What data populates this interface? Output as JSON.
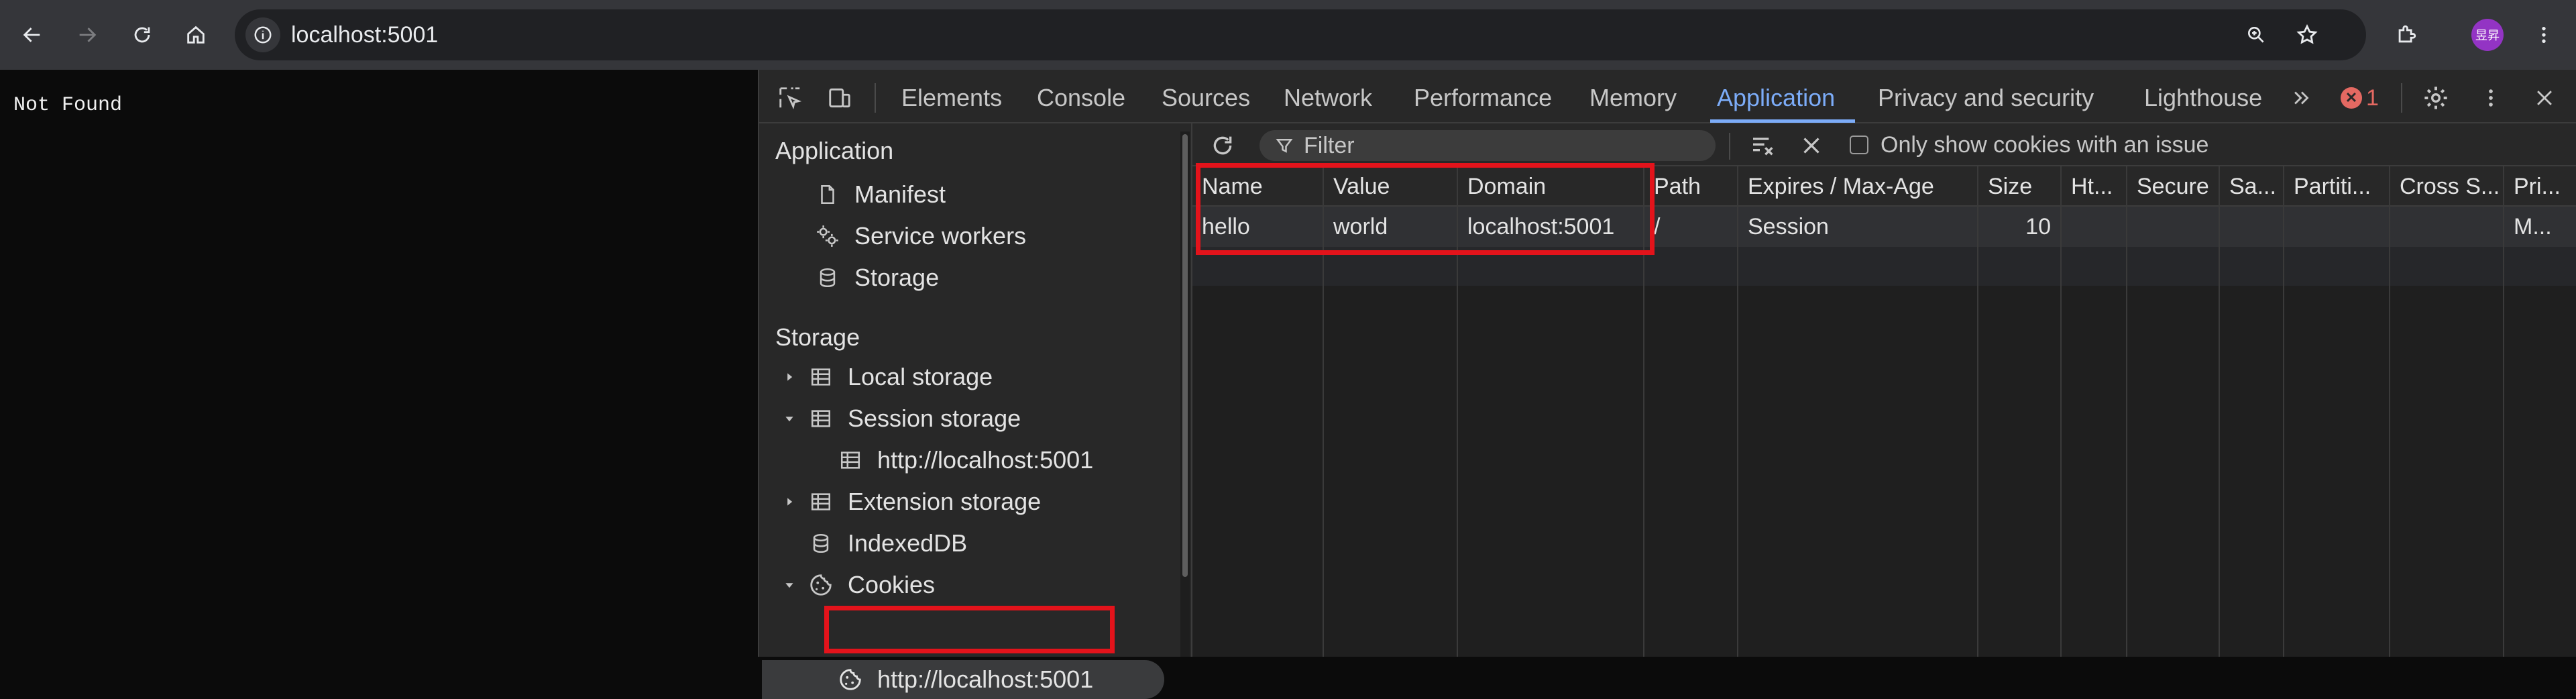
{
  "browser": {
    "url": "localhost:5001",
    "avatar_text": "昱昇"
  },
  "page": {
    "text": "Not Found"
  },
  "devtools": {
    "tabs": [
      "Elements",
      "Console",
      "Sources",
      "Network",
      "Performance",
      "Memory",
      "Application",
      "Privacy and security",
      "Lighthouse"
    ],
    "active_tab": "Application",
    "error_count": "1",
    "sidebar": {
      "application_heading": "Application",
      "application_items": [
        {
          "label": "Manifest",
          "icon": "file-icon"
        },
        {
          "label": "Service workers",
          "icon": "gears-icon"
        },
        {
          "label": "Storage",
          "icon": "database-icon"
        }
      ],
      "storage_heading": "Storage",
      "storage_items": [
        {
          "label": "Local storage",
          "icon": "table-icon",
          "expanded": false
        },
        {
          "label": "Session storage",
          "icon": "table-icon",
          "expanded": true
        },
        {
          "label": "http://localhost:5001",
          "icon": "table-icon",
          "child": true
        },
        {
          "label": "Extension storage",
          "icon": "table-icon",
          "expanded": false
        },
        {
          "label": "IndexedDB",
          "icon": "database-icon"
        },
        {
          "label": "Cookies",
          "icon": "cookie-icon",
          "expanded": true
        },
        {
          "label": "http://localhost:5001",
          "icon": "cookie-icon",
          "child": true,
          "selected": true
        }
      ]
    },
    "cookies": {
      "filter_placeholder": "Filter",
      "only_issue_label": "Only show cookies with an issue",
      "columns": [
        "Name",
        "Value",
        "Domain",
        "Path",
        "Expires / Max-Age",
        "Size",
        "Ht...",
        "Secure",
        "Sa...",
        "Partiti...",
        "Cross S...",
        "Pri..."
      ],
      "rows": [
        [
          "hello",
          "world",
          "localhost:5001",
          "/",
          "Session",
          "10",
          "",
          "",
          "",
          "",
          "",
          "M..."
        ]
      ]
    }
  },
  "colors": {
    "accent": "#7cacf8",
    "highlight": "#e3131b",
    "error": "#e46962"
  }
}
